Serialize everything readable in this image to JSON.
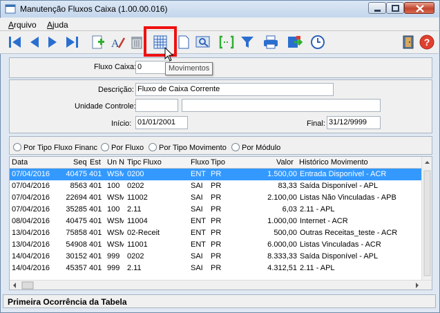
{
  "window": {
    "title": "Manutenção Fluxos Caixa (1.00.00.016)"
  },
  "menu": [
    {
      "first": "A",
      "rest": "rquivo"
    },
    {
      "first": "A",
      "rest": "juda"
    }
  ],
  "toolbar": {
    "icons": [
      "first-record-icon",
      "previous-record-icon",
      "next-record-icon",
      "last-record-icon",
      "add-icon",
      "edit-icon",
      "delete-icon",
      "movimentos-grid-icon",
      "new-document-icon",
      "preview-icon",
      "select-range-icon",
      "filter-icon",
      "print-icon",
      "export-icon",
      "clock-icon",
      "exit-door-icon",
      "help-icon"
    ],
    "tooltip": "Movimentos"
  },
  "form": {
    "fluxo_caixa_label": "Fluxo Caixa:",
    "fluxo_caixa_value": "0",
    "descricao_label": "Descrição:",
    "descricao_value": "Fluxo de Caixa Corrente",
    "unidade_label": "Unidade Controle:",
    "unidade_code": "",
    "unidade_name": "",
    "inicio_label": "Início:",
    "inicio_value": "01/01/2001",
    "final_label": "Final:",
    "final_value": "31/12/9999"
  },
  "radios": [
    "Por Tipo Fluxo Financ",
    "Por Fluxo",
    "Por Tipo Movimento",
    "Por Módulo"
  ],
  "table": {
    "columns": [
      "Data",
      "Seq",
      "Est",
      "Un N",
      "Tipc",
      "Fluxo",
      "Fluxo",
      "Tipo",
      "Valor",
      "Histórico Movimento"
    ],
    "rows": [
      [
        "07/04/2016",
        "40475",
        "401",
        "WSM",
        "0200",
        "ENT",
        "PR",
        "1.500,00",
        "Entrada Disponível - ACR"
      ],
      [
        "07/04/2016",
        "8563",
        "401",
        "100",
        "0202",
        "SAI",
        "PR",
        "83,33",
        "Saída Disponível - APL"
      ],
      [
        "07/04/2016",
        "22694",
        "401",
        "WSM",
        "11002",
        "SAI",
        "PR",
        "2.100,00",
        "Listas Não Vinculadas - APB"
      ],
      [
        "07/04/2016",
        "35285",
        "401",
        "100",
        "2.11",
        "SAI",
        "PR",
        "6,03",
        "2.11 - APL"
      ],
      [
        "08/04/2016",
        "40475",
        "401",
        "WSM",
        "11004",
        "ENT",
        "PR",
        "1.000,00",
        "Internet - ACR"
      ],
      [
        "13/04/2016",
        "75858",
        "401",
        "WSM",
        "02-Receit",
        "ENT",
        "PR",
        "500,00",
        "Outras Receitas_teste - ACR"
      ],
      [
        "13/04/2016",
        "54908",
        "401",
        "WSM",
        "11001",
        "ENT",
        "PR",
        "6.000,00",
        "Listas Vinculadas - ACR"
      ],
      [
        "14/04/2016",
        "30152",
        "401",
        "999",
        "0202",
        "SAI",
        "PR",
        "8.333,33",
        "Saída Disponível - APL"
      ],
      [
        "14/04/2016",
        "45357",
        "401",
        "999",
        "2.11",
        "SAI",
        "PR",
        "4.312,51",
        "2.11 - APL"
      ]
    ]
  },
  "status": {
    "text": "Primeira Ocorrência da Tabela"
  }
}
